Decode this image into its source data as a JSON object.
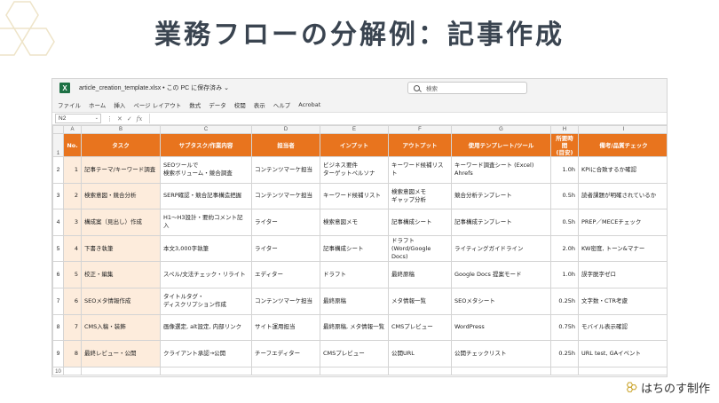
{
  "slide": {
    "title": "業務フローの分解例：記事作成",
    "brand": "はちのす制作"
  },
  "colors": {
    "header_orange": "#e8741e",
    "task_fill": "#fdecdc",
    "excel_green": "#1e7145",
    "title_text": "#3a4450",
    "hex_outline": "#eee4c8"
  },
  "excel": {
    "logo": "X",
    "file_title": "article_creation_template.xlsx • この PC に保存済み ⌄",
    "search_placeholder": "検索",
    "menu": [
      "ファイル",
      "ホーム",
      "挿入",
      "ページ レイアウト",
      "数式",
      "データ",
      "校閲",
      "表示",
      "ヘルプ",
      "Acrobat"
    ],
    "name_box": "N2",
    "name_box_caret": "⌄",
    "fx_icons": [
      "⋮",
      "✕",
      "✓",
      "fx"
    ],
    "column_letters": [
      "A",
      "B",
      "C",
      "D",
      "E",
      "F",
      "G",
      "H",
      "I"
    ],
    "row_numbers": [
      "1",
      "2",
      "3",
      "4",
      "5",
      "6",
      "7",
      "8",
      "9",
      "10"
    ],
    "headers": [
      "No.",
      "タスク",
      "サブタスク/作業内容",
      "担当者",
      "インプット",
      "アウトプット",
      "使用テンプレート/ツール",
      "所要時間\n(目安)",
      "備考/品質チェック"
    ],
    "rows": [
      [
        "1",
        "記事テーマ/キーワード調査",
        "SEOツールで\n検索ボリューム・競合調査",
        "コンテンツマーケ担当",
        "ビジネス要件\nターゲットペルソナ",
        "キーワード候補リスト",
        "キーワード調査シート (Excel)\nAhrefs",
        "1.0h",
        "KPIに合致するか確認"
      ],
      [
        "2",
        "検索意図・競合分析",
        "SERP確認・競合記事構造把握",
        "コンテンツマーケ担当",
        "キーワード候補リスト",
        "検索意図メモ\nギャップ分析",
        "競合分析テンプレート",
        "0.5h",
        "読者課題が明確されているか"
      ],
      [
        "3",
        "構成案（見出し）作成",
        "H1〜H3設計・要約コメント記入",
        "ライター",
        "検索意図メモ",
        "記事構成シート",
        "記事構成テンプレート",
        "0.5h",
        "PREP／MECEチェック"
      ],
      [
        "4",
        "下書き執筆",
        "本文3,000字執筆",
        "ライター",
        "記事構成シート",
        "ドラフト\n(Word/Google Docs)",
        "ライティングガイドライン",
        "2.0h",
        "KW密度, トーン&マナー"
      ],
      [
        "5",
        "校正・編集",
        "スペル/文法チェック・リライト",
        "エディター",
        "ドラフト",
        "最終原稿",
        "Google Docs 提案モード",
        "1.0h",
        "誤字脱字ゼロ"
      ],
      [
        "6",
        "SEOメタ情報作成",
        "タイトルタグ・\nディスクリプション作成",
        "コンテンツマーケ担当",
        "最終原稿",
        "メタ情報一覧",
        "SEOメタシート",
        "0.25h",
        "文字数・CTR考慮"
      ],
      [
        "7",
        "CMS入稿・装飾",
        "画像選定, alt設定, 内部リンク",
        "サイト運用担当",
        "最終原稿, メタ情報一覧",
        "CMSプレビュー",
        "WordPress",
        "0.75h",
        "モバイル表示確認"
      ],
      [
        "8",
        "最終レビュー・公開",
        "クライアント承認→公開",
        "チーフエディター",
        "CMSプレビュー",
        "公開URL",
        "公開チェックリスト",
        "0.25h",
        "URL test, GAイベント"
      ]
    ]
  }
}
